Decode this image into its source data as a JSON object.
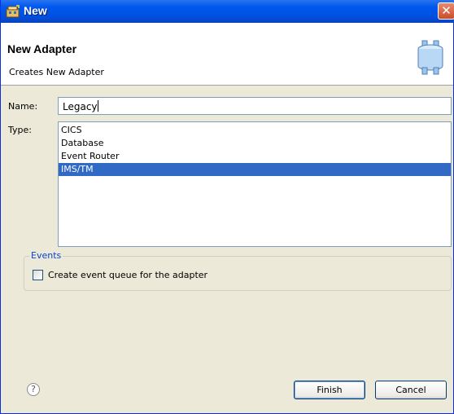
{
  "window": {
    "title": "New",
    "close_symbol": "✕"
  },
  "banner": {
    "title": "New Adapter",
    "subtitle": "Creates New Adapter",
    "icon": "adapter-cylinder-icon"
  },
  "form": {
    "name_label": "Name:",
    "name_value": "Legacy",
    "type_label": "Type:",
    "types": [
      {
        "label": "CICS",
        "selected": false
      },
      {
        "label": "Database",
        "selected": false
      },
      {
        "label": "Event Router",
        "selected": false
      },
      {
        "label": "IMS/TM",
        "selected": true
      }
    ]
  },
  "events": {
    "legend": "Events",
    "checkbox_label": "Create event queue for the adapter",
    "checked": false
  },
  "footer": {
    "help_symbol": "?",
    "finish_label": "Finish",
    "cancel_label": "Cancel"
  },
  "colors": {
    "title_bar": "#0058ee",
    "selection": "#3169c6",
    "group_legend": "#0046d5",
    "dialog_bg": "#ece9d8"
  }
}
